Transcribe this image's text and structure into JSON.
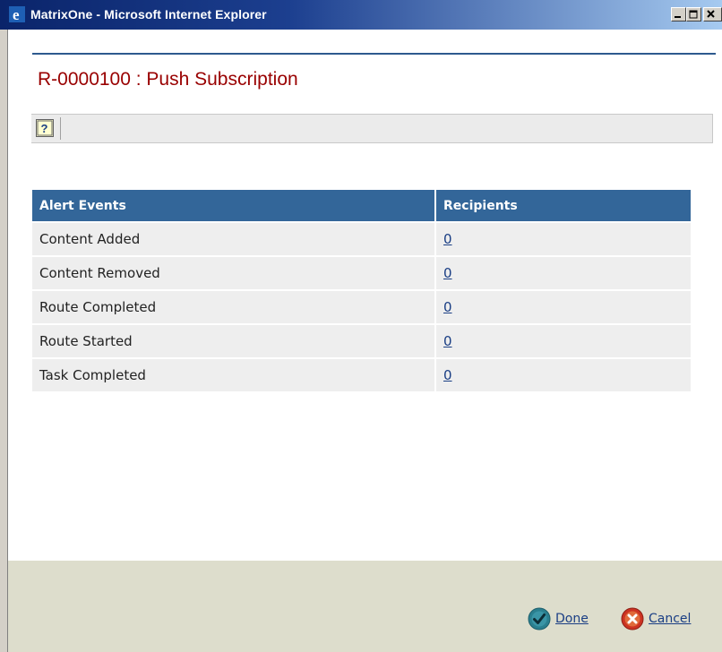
{
  "window": {
    "title": "MatrixOne - Microsoft Internet Explorer"
  },
  "page": {
    "title": "R-0000100 : Push Subscription"
  },
  "toolbar": {
    "help_icon": "help-icon"
  },
  "table": {
    "headers": [
      "Alert Events",
      "Recipients"
    ],
    "rows": [
      {
        "event": "Content Added",
        "recipients": "0"
      },
      {
        "event": "Content Removed",
        "recipients": "0"
      },
      {
        "event": "Route Completed",
        "recipients": "0"
      },
      {
        "event": "Route Started",
        "recipients": "0"
      },
      {
        "event": "Task Completed",
        "recipients": "0"
      }
    ]
  },
  "footer": {
    "done_label": "Done",
    "cancel_label": "Cancel"
  },
  "colors": {
    "title_red": "#990000",
    "header_blue": "#336699",
    "link_blue": "#1a3e84",
    "done_teal": "#2a7f8f",
    "cancel_red": "#cc3322"
  }
}
